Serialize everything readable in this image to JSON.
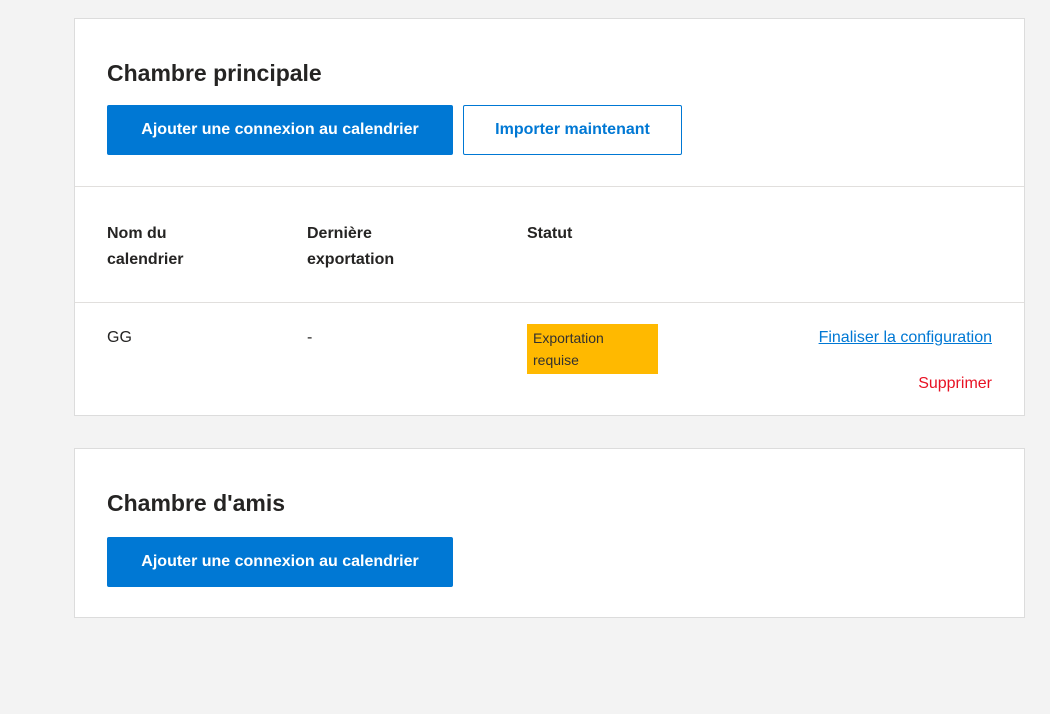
{
  "rooms": [
    {
      "title": "Chambre principale",
      "add_button": "Ajouter une connexion au calendrier",
      "import_button": "Importer maintenant",
      "table": {
        "headers": [
          "Nom du calendrier",
          "Dernière exportation",
          "Statut"
        ],
        "rows": [
          {
            "name": "GG",
            "last_export": "-",
            "status": "Exportation requise",
            "action_finalize": "Finaliser la configuration",
            "action_delete": "Supprimer"
          }
        ]
      }
    },
    {
      "title": "Chambre d'amis",
      "add_button": "Ajouter une connexion au calendrier"
    }
  ],
  "colors": {
    "page_background": "#f3f3f3",
    "accent": "#0078d4",
    "status_warning": "#ffb900",
    "danger": "#e81123"
  }
}
